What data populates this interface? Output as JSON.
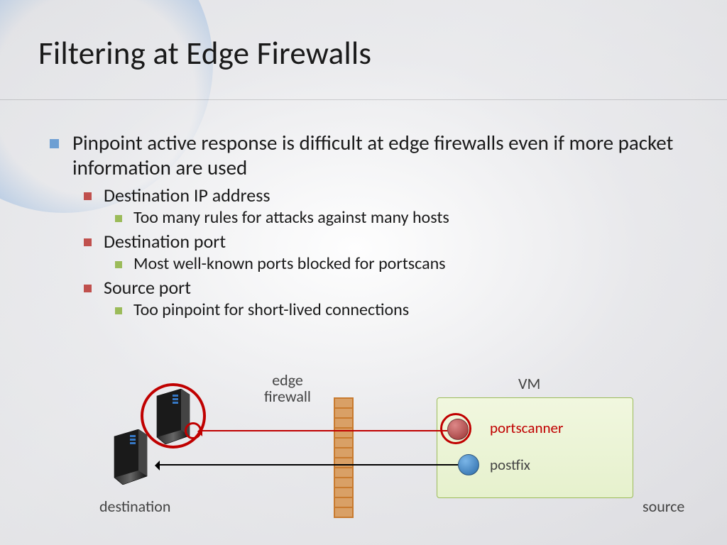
{
  "title": "Filtering at Edge Firewalls",
  "bullets": {
    "main": "Pinpoint active response is difficult at edge firewalls even if more packet information are used",
    "items": [
      {
        "label": "Destination IP address",
        "sub": [
          "Too many rules for attacks against many hosts"
        ]
      },
      {
        "label": "Destination port",
        "sub": [
          "Most well-known ports blocked for portscans"
        ]
      },
      {
        "label": "Source port",
        "sub": [
          "Too pinpoint for short-lived connections"
        ]
      }
    ]
  },
  "diagram": {
    "edge_firewall_label": "edge\nfirewall",
    "vm_label": "VM",
    "portscanner_label": "portscanner",
    "postfix_label": "postfix",
    "destination_label": "destination",
    "source_label": "source"
  }
}
